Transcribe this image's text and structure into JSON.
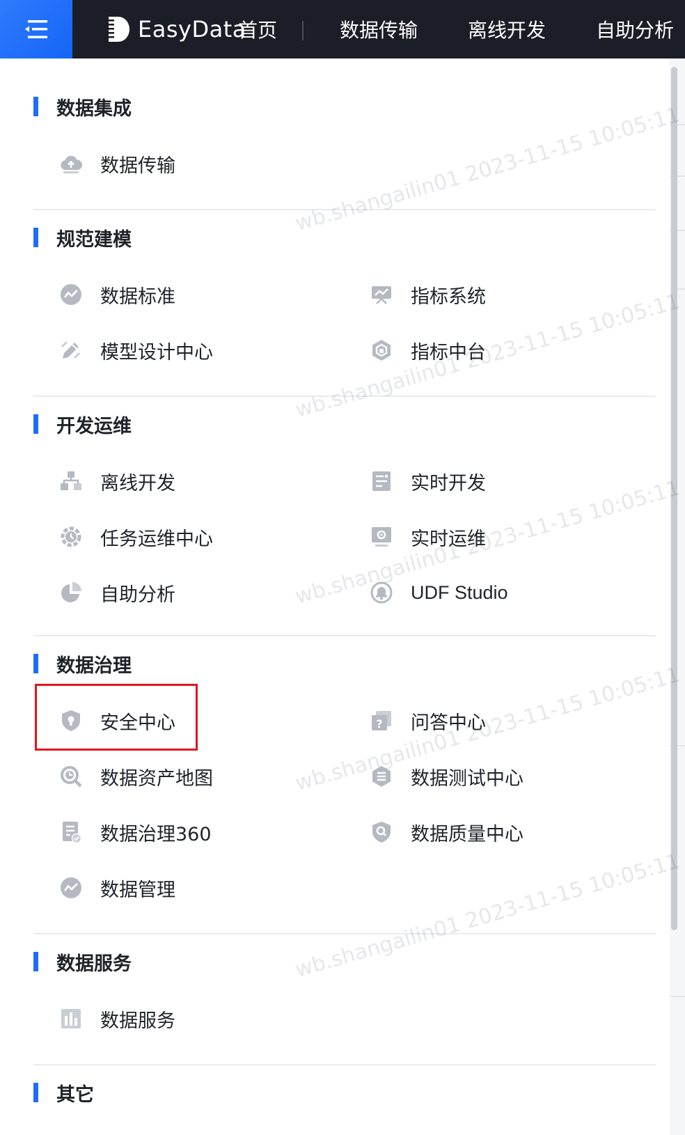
{
  "header": {
    "menu_icon": "menu-collapse-icon",
    "logo_icon": "easydata-logo-icon",
    "logo_text": "EasyData",
    "nav": [
      "首页",
      "数据传输",
      "离线开发",
      "自助分析"
    ]
  },
  "sections": [
    {
      "title": "数据集成",
      "items": [
        {
          "label": "数据传输",
          "icon": "cloud-upload-icon"
        }
      ]
    },
    {
      "title": "规范建模",
      "items": [
        {
          "label": "数据标准",
          "icon": "trend-circle-icon"
        },
        {
          "label": "指标系统",
          "icon": "presentation-chart-icon"
        },
        {
          "label": "模型设计中心",
          "icon": "pencil-design-icon"
        },
        {
          "label": "指标中台",
          "icon": "hexagon-layers-icon"
        }
      ]
    },
    {
      "title": "开发运维",
      "items": [
        {
          "label": "离线开发",
          "icon": "hierarchy-icon"
        },
        {
          "label": "实时开发",
          "icon": "document-list-icon"
        },
        {
          "label": "任务运维中心",
          "icon": "gear-cycle-icon"
        },
        {
          "label": "实时运维",
          "icon": "monitor-gear-icon"
        },
        {
          "label": "自助分析",
          "icon": "pie-chart-icon"
        },
        {
          "label": "UDF Studio",
          "icon": "udf-bell-icon"
        }
      ]
    },
    {
      "title": "数据治理",
      "items": [
        {
          "label": "安全中心",
          "icon": "shield-icon"
        },
        {
          "label": "问答中心",
          "icon": "question-card-icon"
        },
        {
          "label": "数据资产地图",
          "icon": "magnifier-chart-icon"
        },
        {
          "label": "数据测试中心",
          "icon": "hexagon-list-icon"
        },
        {
          "label": "数据治理360",
          "icon": "document-check-icon"
        },
        {
          "label": "数据质量中心",
          "icon": "shield-search-icon"
        },
        {
          "label": "数据管理",
          "icon": "trend-circle-icon"
        }
      ]
    },
    {
      "title": "数据服务",
      "items": [
        {
          "label": "数据服务",
          "icon": "bar-building-icon"
        }
      ]
    },
    {
      "title": "其它",
      "items": []
    }
  ],
  "highlight_target": "安全中心",
  "watermark": "wb.shangailin01 2023-11-15 10:05:11",
  "colors": {
    "accent": "#1f6bff",
    "topbar": "#1b1e26",
    "highlight": "#e4141b",
    "icon": "#b4b9c2"
  }
}
